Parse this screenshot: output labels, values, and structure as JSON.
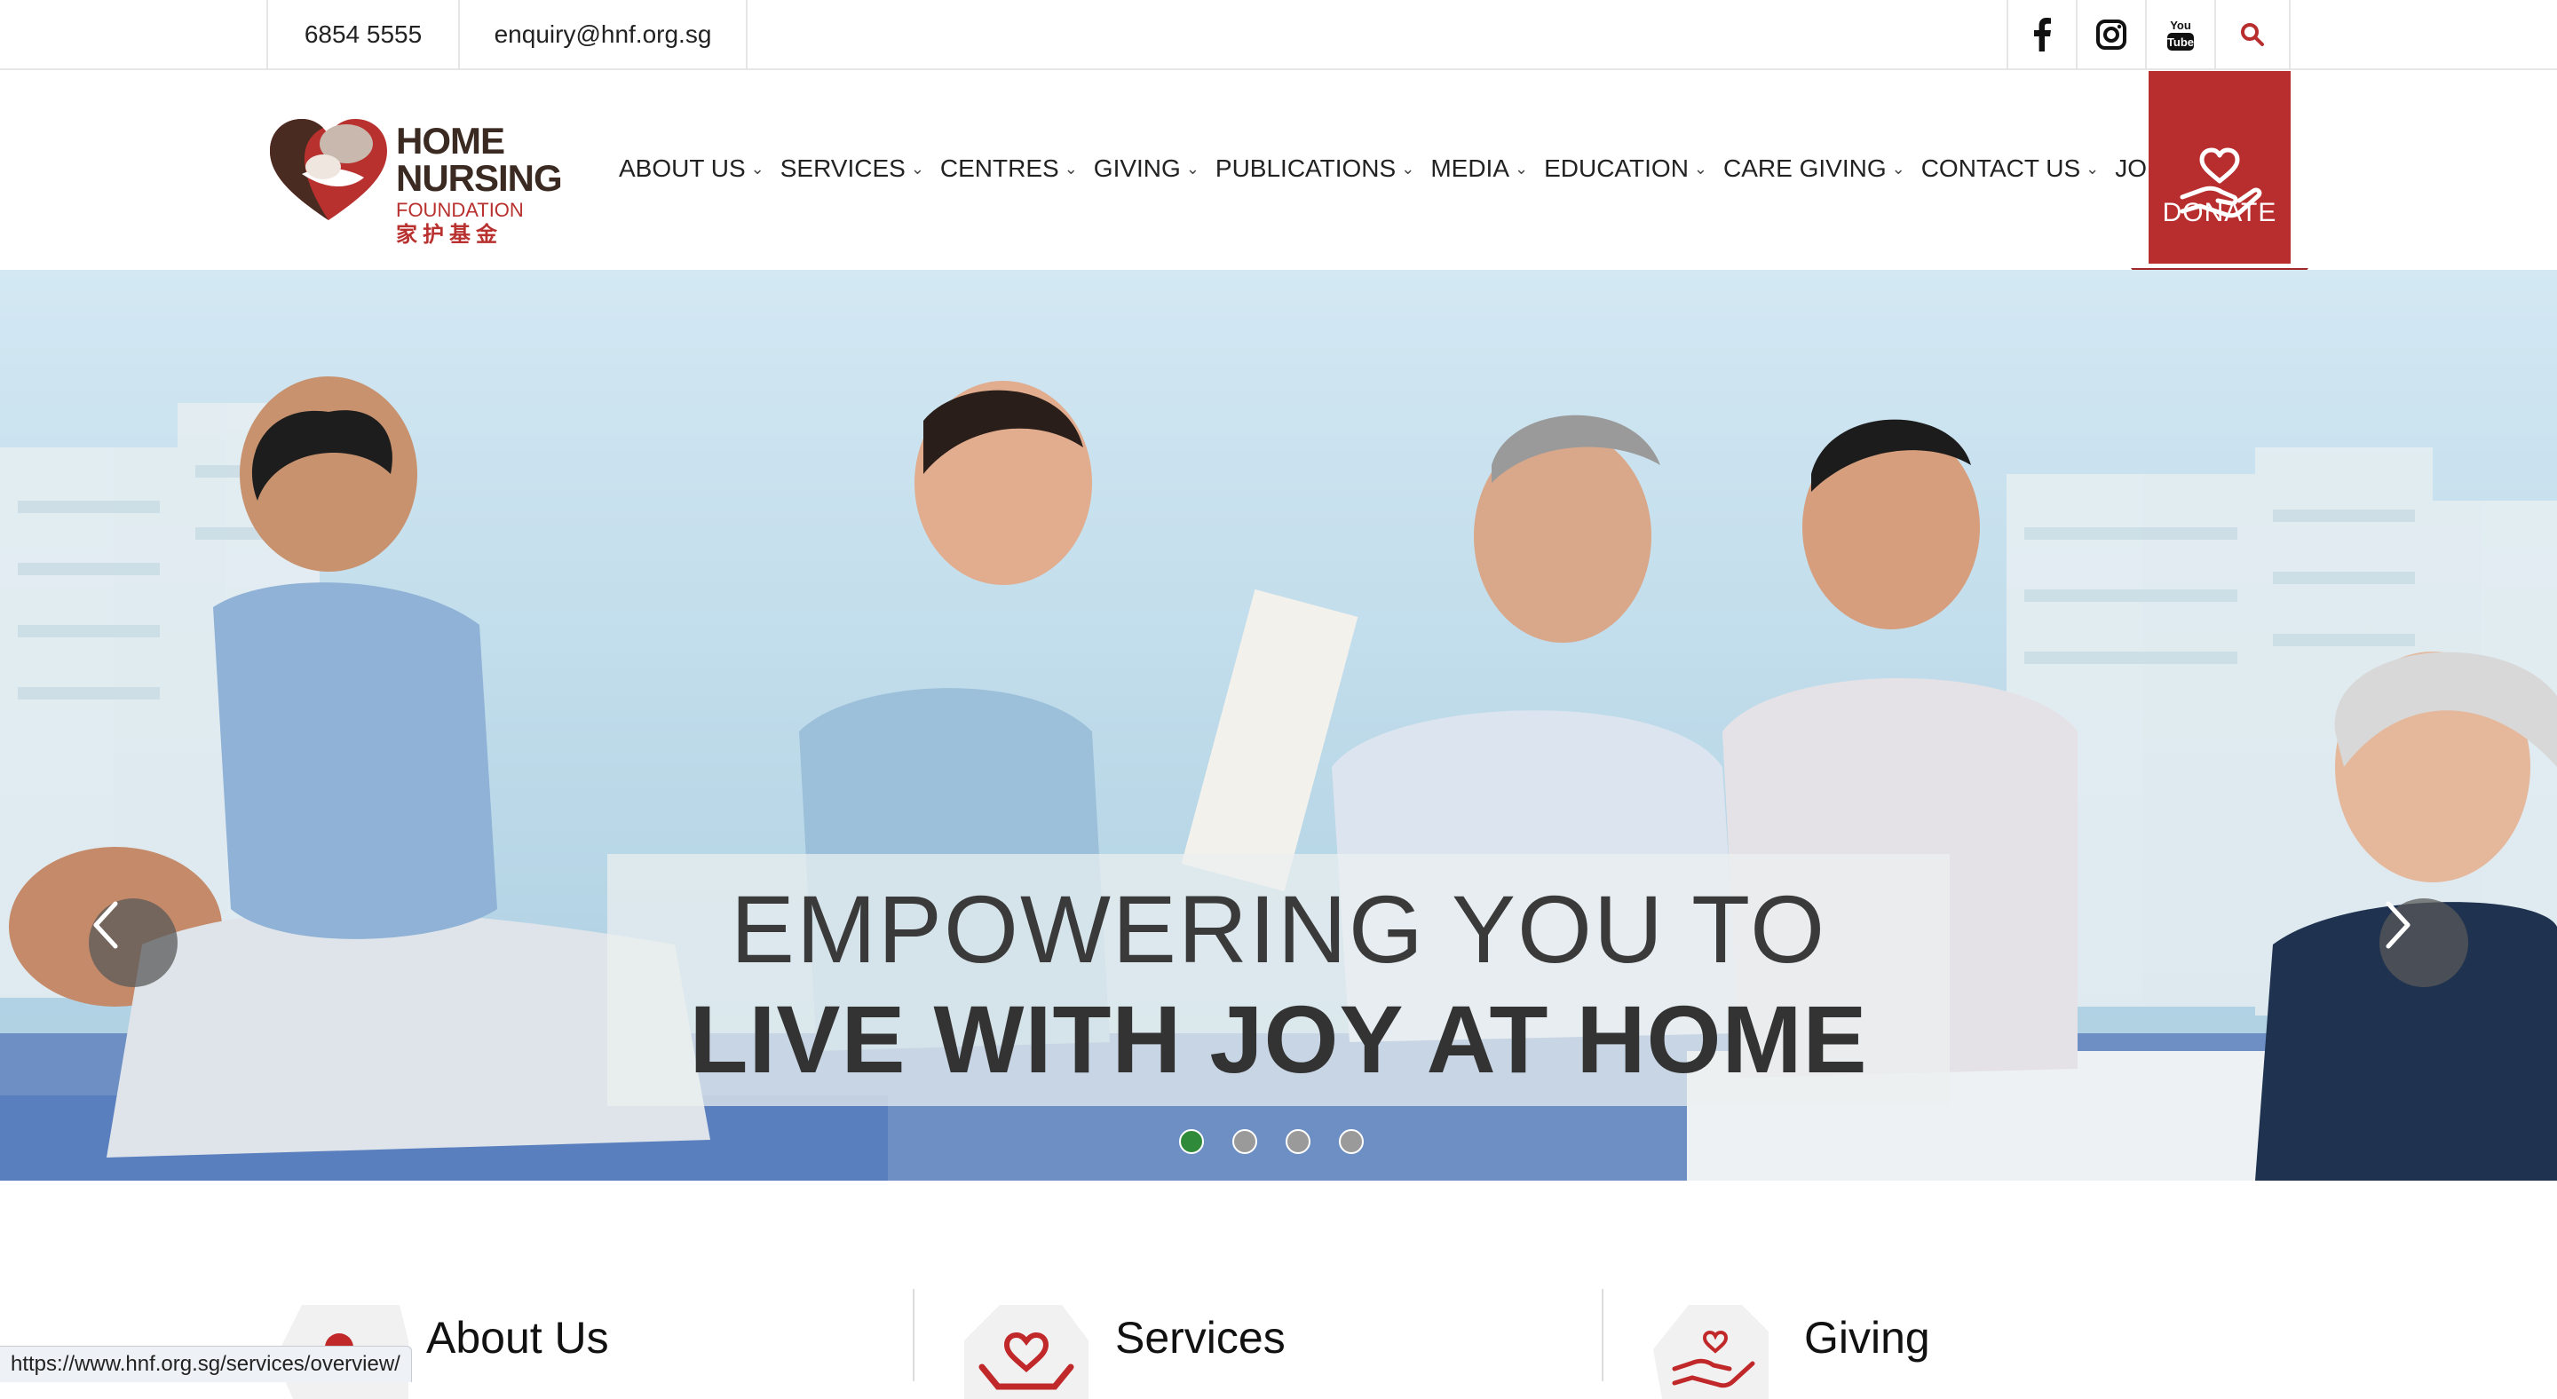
{
  "topbar": {
    "phone": "6854 5555",
    "email": "enquiry@hnf.org.sg",
    "social": [
      "facebook-icon",
      "instagram-icon",
      "youtube-icon"
    ],
    "youtube_text": "You Tube",
    "search_icon": "search-icon"
  },
  "logo": {
    "line1": "HOME",
    "line2": "NURSING",
    "line3": "FOUNDATION",
    "line4": "家护基金"
  },
  "nav": {
    "items": [
      {
        "label": "ABOUT US"
      },
      {
        "label": "SERVICES"
      },
      {
        "label": "CENTRES"
      },
      {
        "label": "GIVING"
      },
      {
        "label": "PUBLICATIONS"
      },
      {
        "label": "MEDIA"
      },
      {
        "label": "EDUCATION"
      },
      {
        "label": "CARE GIVING"
      },
      {
        "label": "CONTACT US"
      },
      {
        "label": "JOIN US"
      }
    ],
    "chevron": "⌄"
  },
  "donate": {
    "label": "DONATE"
  },
  "hero": {
    "caption_line1": "EMPOWERING YOU TO",
    "caption_line2": "LIVE WITH JOY AT HOME",
    "slide_count": 4,
    "active_slide": 1
  },
  "features": [
    {
      "title": "About Us"
    },
    {
      "title": "Services"
    },
    {
      "title": "Giving"
    }
  ],
  "status_bar": {
    "url": "https://www.hnf.org.sg/services/overview/"
  },
  "colors": {
    "brand_red": "#b82e2e",
    "active_dot": "#2f8a3a"
  }
}
